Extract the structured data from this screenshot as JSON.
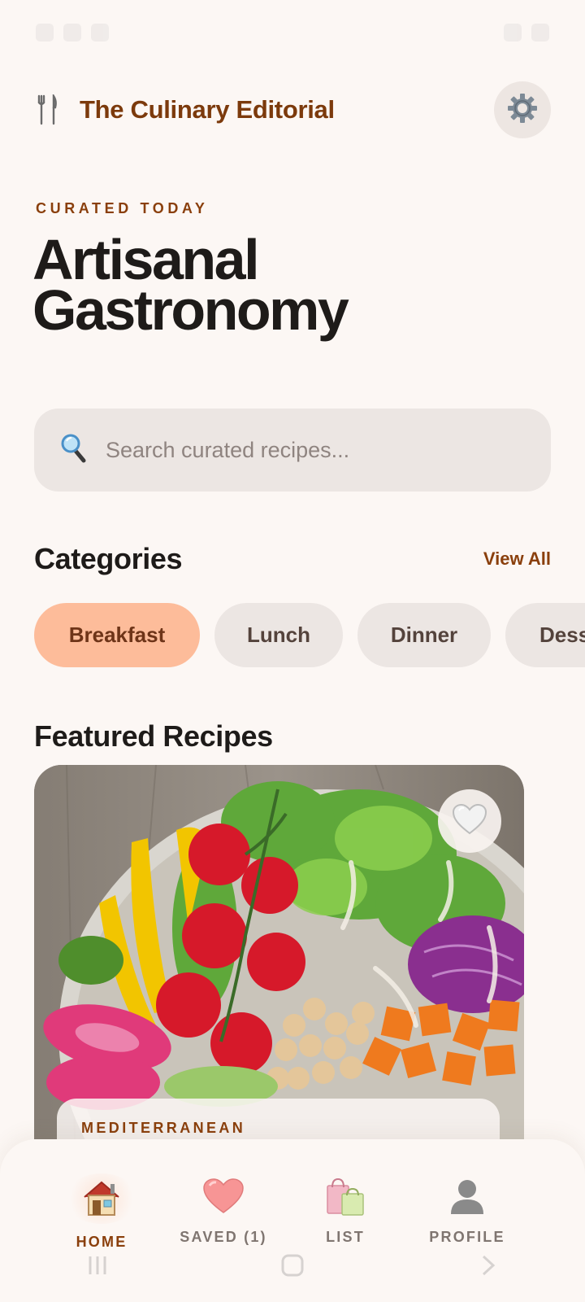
{
  "app": {
    "title": "The Culinary Editorial"
  },
  "hero": {
    "eyebrow": "CURATED TODAY",
    "title_line1": "Artisanal",
    "title_line2": "Gastronomy"
  },
  "search": {
    "placeholder": "Search curated recipes..."
  },
  "categories": {
    "title": "Categories",
    "view_all": "View All",
    "items": [
      {
        "label": "Breakfast",
        "active": true
      },
      {
        "label": "Lunch",
        "active": false
      },
      {
        "label": "Dinner",
        "active": false
      },
      {
        "label": "Dessert",
        "active": false
      }
    ]
  },
  "featured": {
    "title": "Featured Recipes",
    "cards": [
      {
        "tag": "MEDITERRANEAN",
        "image": "salad-bowl-photo",
        "favorite_icon": "heart-icon"
      }
    ]
  },
  "bottom_nav": {
    "items": [
      {
        "label": "HOME",
        "icon": "home-icon",
        "active": true
      },
      {
        "label": "SAVED (1)",
        "icon": "heart-icon",
        "active": false
      },
      {
        "label": "LIST",
        "icon": "shopping-bags-icon",
        "active": false
      },
      {
        "label": "PROFILE",
        "icon": "profile-icon",
        "active": false
      }
    ]
  },
  "colors": {
    "background": "#fcf7f4",
    "accent": "#8a3f0c",
    "chip_active": "#fdbc9a",
    "chip_inactive": "#ece6e3",
    "text_primary": "#1e1b19"
  }
}
